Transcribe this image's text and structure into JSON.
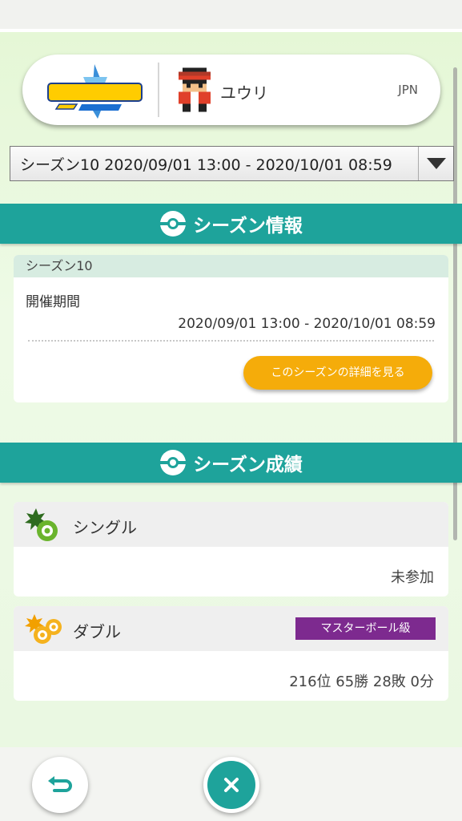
{
  "trainer": {
    "name": "ユウリ",
    "country": "JPN"
  },
  "season_select": {
    "selected": "シーズン10 2020/09/01 13:00 - 2020/10/01 08:59"
  },
  "season_info": {
    "header": "シーズン情報",
    "season_label": "シーズン10",
    "period_label": "開催期間",
    "period_value": "2020/09/01 13:00 - 2020/10/01 08:59",
    "details_button": "このシーズンの詳細を見る"
  },
  "season_results": {
    "header": "シーズン成績",
    "single": {
      "label": "シングル",
      "result": "未参加"
    },
    "double": {
      "label": "ダブル",
      "rank_badge": "マスターボール級",
      "result": "216位 65勝 28敗 0分"
    }
  },
  "colors": {
    "teal": "#1ea39b",
    "orange": "#f5ac0a",
    "purple": "#7d2a8f"
  },
  "icons": {
    "back": "return-arrow-icon",
    "close": "close-icon"
  }
}
